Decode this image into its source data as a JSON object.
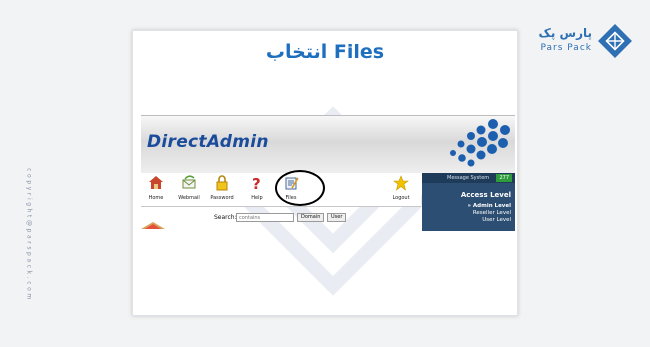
{
  "sidebar": {
    "copyright": "copyright@parspack.com"
  },
  "brand": {
    "name_fa": "پارس پک",
    "name_en": "Pars Pack",
    "logo_icon": "parspack-logo-icon"
  },
  "slide": {
    "title": "انتخاب Files",
    "accent": "#1f6fbf"
  },
  "directadmin": {
    "logo_text": "DirectAdmin",
    "nav": [
      {
        "label": "Home",
        "icon": "home-icon"
      },
      {
        "label": "Webmail",
        "icon": "webmail-icon"
      },
      {
        "label": "Password",
        "icon": "password-lock-icon"
      },
      {
        "label": "Help",
        "icon": "help-icon"
      },
      {
        "label": "Files",
        "icon": "files-icon"
      },
      {
        "label": "Logout",
        "icon": "logout-star-icon"
      }
    ],
    "message_system": {
      "label": "Message System",
      "count": "277"
    },
    "access": {
      "title": "Access Level",
      "levels": [
        "» Admin Level",
        "Reseller Level",
        "User Level"
      ]
    },
    "search": {
      "label": "Search:",
      "placeholder": "contains",
      "button_domain": "Domain",
      "button_user": "User"
    }
  }
}
